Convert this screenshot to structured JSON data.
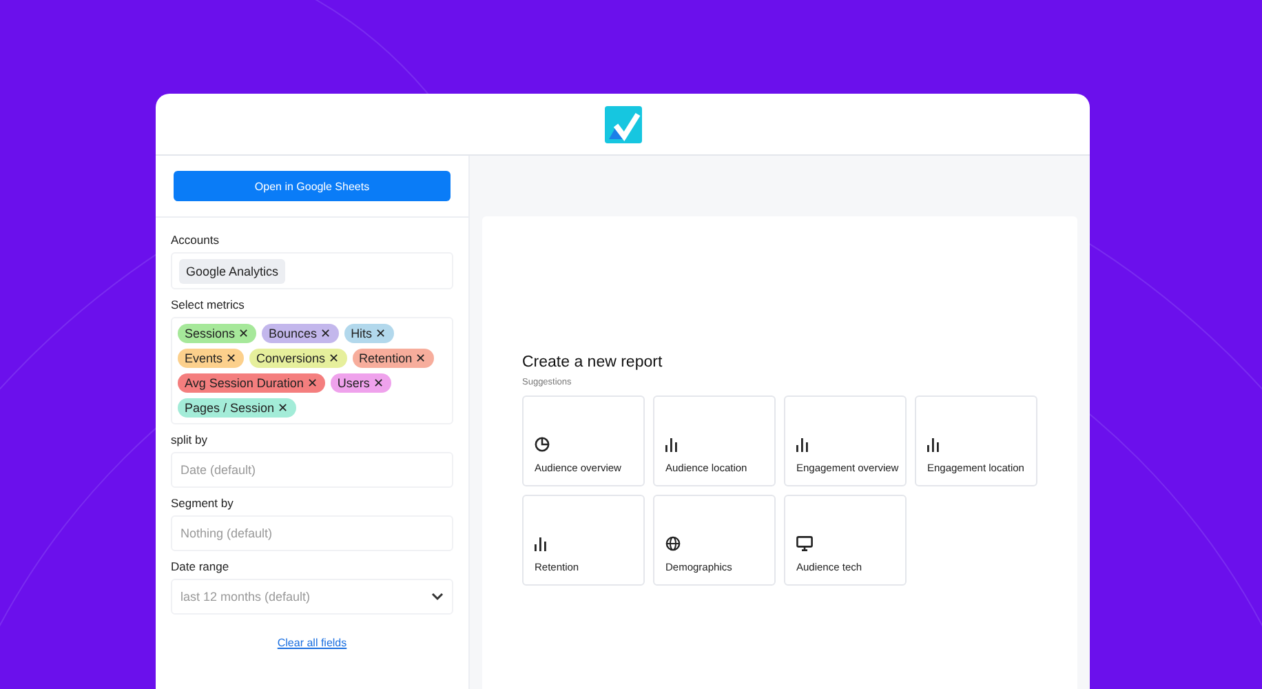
{
  "sidebar": {
    "open_button": "Open in Google Sheets",
    "accounts": {
      "label": "Accounts",
      "value": "Google Analytics"
    },
    "metrics": {
      "label": "Select metrics",
      "remove_glyph": "✕",
      "items": [
        {
          "label": "Sessions",
          "color": "#a6e89a"
        },
        {
          "label": "Bounces",
          "color": "#c3b7ec"
        },
        {
          "label": "Hits",
          "color": "#b2d8ec"
        },
        {
          "label": "Events",
          "color": "#fcd08c"
        },
        {
          "label": "Conversions",
          "color": "#e6ef9c"
        },
        {
          "label": "Retention",
          "color": "#f7ad9c"
        },
        {
          "label": "Avg Session Duration",
          "color": "#f47e7e"
        },
        {
          "label": "Users",
          "color": "#efa2ec"
        },
        {
          "label": "Pages / Session",
          "color": "#a3ecd8"
        }
      ]
    },
    "fields": [
      {
        "kind": "input",
        "label": "split by",
        "placeholder": "Date (default)"
      },
      {
        "kind": "input",
        "label": "Segment by",
        "placeholder": "Nothing (default)"
      },
      {
        "kind": "select",
        "label": "Date range",
        "placeholder": "last 12 months (default)"
      }
    ],
    "clear_link": "Clear all fields"
  },
  "main": {
    "title": "Create a new report",
    "subtitle": "Suggestions",
    "suggestions": [
      {
        "kind": "pie",
        "label": "Audience overview"
      },
      {
        "kind": "bar",
        "label": "Audience location"
      },
      {
        "kind": "bar",
        "label": "Engagement overview"
      },
      {
        "kind": "bar",
        "label": "Engagement location"
      },
      {
        "kind": "bar",
        "label": "Retention"
      },
      {
        "kind": "globe",
        "label": "Demographics"
      },
      {
        "kind": "monitor",
        "label": "Audience tech"
      }
    ]
  }
}
